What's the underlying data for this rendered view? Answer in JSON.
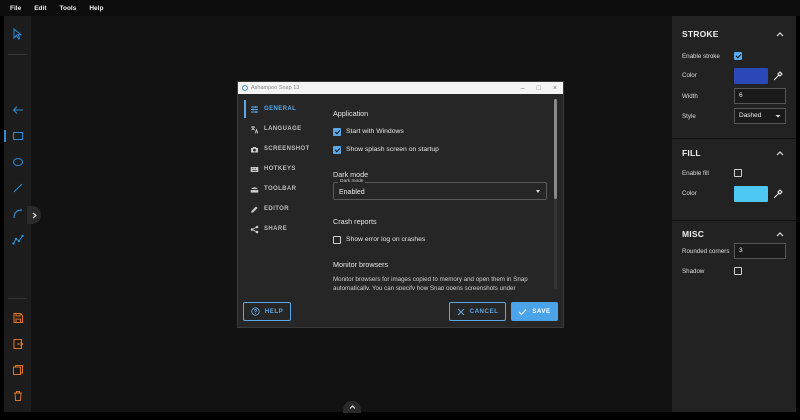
{
  "menu": [
    "File",
    "Edit",
    "Tools",
    "Help"
  ],
  "dialog": {
    "title": "Ashampoo Snap 13",
    "nav": [
      {
        "label": "GENERAL",
        "icon": "sliders-icon",
        "active": true
      },
      {
        "label": "LANGUAGE",
        "icon": "translate-icon",
        "active": false
      },
      {
        "label": "SCREENSHOT",
        "icon": "camera-icon",
        "active": false
      },
      {
        "label": "HOTKEYS",
        "icon": "keyboard-icon",
        "active": false
      },
      {
        "label": "TOOLBAR",
        "icon": "toolbar-icon",
        "active": false
      },
      {
        "label": "EDITOR",
        "icon": "pencil-icon",
        "active": false
      },
      {
        "label": "SHARE",
        "icon": "share-icon",
        "active": false
      }
    ],
    "content": {
      "application_heading": "Application",
      "start_with_windows": {
        "label": "Start with Windows",
        "checked": true
      },
      "splash_screen": {
        "label": "Show splash screen on startup",
        "checked": true
      },
      "dark_mode_heading": "Dark mode",
      "dark_mode_select": {
        "legend": "Dark mode",
        "value": "Enabled"
      },
      "crash_reports_heading": "Crash reports",
      "error_log": {
        "label": "Show error log on crashes",
        "checked": false
      },
      "monitor_heading": "Monitor browsers",
      "monitor_text": "Monitor browsers for images copied to memory and open them in Snap automatically. You can specify how Snap opens screenshots under"
    },
    "buttons": {
      "help": "HELP",
      "cancel": "CANCEL",
      "save": "SAVE"
    }
  },
  "right_panel": {
    "stroke": {
      "title": "STROKE",
      "enable_label": "Enable stroke",
      "enable_checked": true,
      "color_label": "Color",
      "color": "#2a48b8",
      "width_label": "Width",
      "width_value": "6",
      "style_label": "Style",
      "style_value": "Dashed"
    },
    "fill": {
      "title": "FILL",
      "enable_label": "Enable fill",
      "enable_checked": false,
      "color_label": "Color",
      "color": "#4ec7f2"
    },
    "misc": {
      "title": "MISC",
      "rounded_label": "Rounded corners",
      "rounded_value": "3",
      "shadow_label": "Shadow",
      "shadow_checked": false
    }
  },
  "colors": {
    "accent": "#5aa8e8",
    "tool_blue": "#2b8fd8",
    "tool_orange": "#e0742a"
  }
}
